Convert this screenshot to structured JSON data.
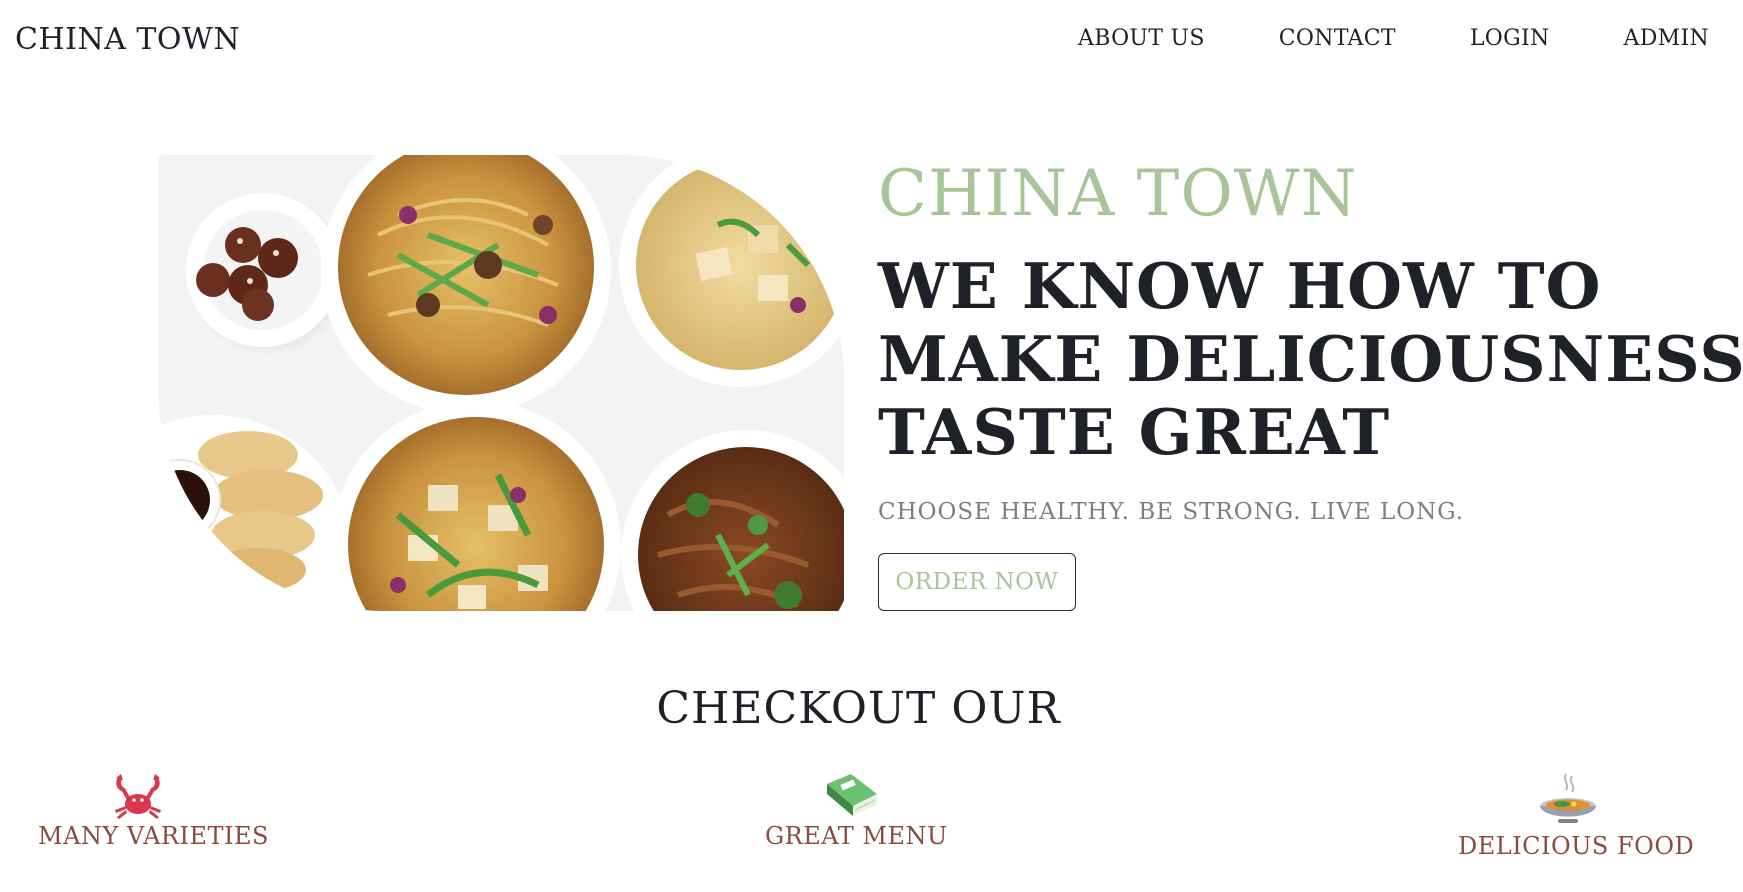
{
  "navbar": {
    "brand": "CHINA TOWN",
    "links": [
      "ABOUT US",
      "CONTACT",
      "LOGIN",
      "ADMIN"
    ]
  },
  "hero": {
    "subbrand": "CHINA TOWN",
    "headline_lines": [
      "WE KNOW HOW TO",
      "MAKE DELICIOUSNESS",
      "TASTE GREAT"
    ],
    "tagline": "CHOOSE HEALTHY. BE STRONG. LIVE LONG.",
    "cta_label": "ORDER NOW"
  },
  "checkout": {
    "title": "CHECKOUT OUR",
    "features": [
      {
        "label": "MANY VARIETIES",
        "icon": "crab-icon"
      },
      {
        "label": "GREAT MENU",
        "icon": "book-icon"
      },
      {
        "label": "DELICIOUS FOOD",
        "icon": "soup-bowl-icon"
      }
    ]
  },
  "colors": {
    "accent_green": "#a7c596",
    "text_dark": "#1f2128",
    "label_brown": "#8b4b3e",
    "tagline_gray": "#7a7e87",
    "crab_red": "#d9374a",
    "book_green": "#5ab05e"
  }
}
